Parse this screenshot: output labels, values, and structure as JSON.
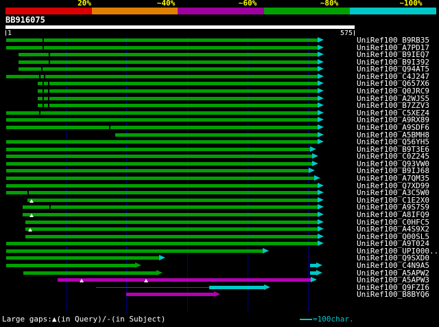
{
  "palette": {
    "background": "#000000",
    "text_white": "#ffffff",
    "label_yellow": "#ffff00",
    "grid_blue": "#000080",
    "green": "#00a000",
    "cyan": "#00c8c8",
    "magenta": "#b400b4",
    "red": "#d80000",
    "orange": "#e08000",
    "purple": "#a000a0",
    "white": "#ffffff",
    "black": "#000000"
  },
  "header": {
    "scale_labels": [
      "20%",
      "~40%",
      "~60%",
      "~80%",
      "~100%"
    ],
    "scale_segment_colors": [
      "red",
      "orange",
      "purple",
      "green",
      "cyan"
    ],
    "query_name": "BB916075",
    "ruler_start": "1",
    "ruler_end": "575"
  },
  "footer": {
    "gaps_legend": "Large gaps:▲(in Query)/-(in Subject)",
    "scale_legend": "=100char."
  },
  "chart_data": {
    "type": "alignment-overview-bar",
    "title": "BLAST hit graphical overview",
    "query_name": "BB916075",
    "query_length": 575,
    "x_range": [
      1,
      575
    ],
    "grid_interval_chars": 100,
    "identity_legend": [
      {
        "label": "20%",
        "color": "red"
      },
      {
        "label": "~40%",
        "color": "orange"
      },
      {
        "label": "~60%",
        "color": "purple"
      },
      {
        "label": "~80%",
        "color": "green"
      },
      {
        "label": "~100%",
        "color": "cyan"
      }
    ],
    "rows": [
      {
        "label": "UniRef100_B9RB35",
        "segments": [
          {
            "color": "green",
            "start": 1,
            "end": 516,
            "arrow": "cyan"
          }
        ],
        "ticks": [
          62
        ],
        "gaps": []
      },
      {
        "label": "UniRef100_A7PD17",
        "segments": [
          {
            "color": "green",
            "start": 1,
            "end": 516,
            "arrow": "cyan"
          }
        ],
        "ticks": [
          62
        ],
        "gaps": []
      },
      {
        "label": "UniRef100_B9IEQ7",
        "segments": [
          {
            "color": "green",
            "start": 22,
            "end": 516,
            "arrow": "cyan"
          }
        ],
        "ticks": [
          73
        ],
        "gaps": []
      },
      {
        "label": "UniRef100_B9I392",
        "segments": [
          {
            "color": "green",
            "start": 22,
            "end": 516,
            "arrow": "cyan"
          }
        ],
        "ticks": [
          73
        ],
        "gaps": []
      },
      {
        "label": "UniRef100_Q94AT5",
        "segments": [
          {
            "color": "green",
            "start": 22,
            "end": 516,
            "arrow": "cyan"
          }
        ],
        "ticks": [
          60
        ],
        "gaps": []
      },
      {
        "label": "UniRef100_C4J247",
        "segments": [
          {
            "color": "green",
            "start": 1,
            "end": 516,
            "arrow": "cyan"
          }
        ],
        "ticks": [
          57,
          65
        ],
        "gaps": []
      },
      {
        "label": "UniRef100_Q657X6",
        "segments": [
          {
            "color": "green",
            "start": 53,
            "end": 516,
            "arrow": "cyan"
          }
        ],
        "ticks": [
          62,
          71
        ],
        "gaps": []
      },
      {
        "label": "UniRef100_Q0JRC9",
        "segments": [
          {
            "color": "green",
            "start": 53,
            "end": 516,
            "arrow": "cyan"
          }
        ],
        "ticks": [
          62,
          71
        ],
        "gaps": []
      },
      {
        "label": "UniRef100_A2WJS5",
        "segments": [
          {
            "color": "green",
            "start": 53,
            "end": 516,
            "arrow": "cyan"
          }
        ],
        "ticks": [
          62,
          71
        ],
        "gaps": []
      },
      {
        "label": "UniRef100_B7ZZV3",
        "segments": [
          {
            "color": "green",
            "start": 53,
            "end": 516,
            "arrow": "cyan"
          }
        ],
        "ticks": [
          62,
          71
        ],
        "gaps": []
      },
      {
        "label": "UniRef100_C5XEZ4",
        "segments": [
          {
            "color": "green",
            "start": 1,
            "end": 516,
            "arrow": "cyan"
          }
        ],
        "ticks": [
          57
        ],
        "gaps": []
      },
      {
        "label": "UniRef100_A9RX89",
        "segments": [
          {
            "color": "green",
            "start": 1,
            "end": 516,
            "arrow": "cyan"
          }
        ],
        "ticks": [],
        "gaps": []
      },
      {
        "label": "UniRef100_A9SDF6",
        "segments": [
          {
            "color": "green",
            "start": 1,
            "end": 516,
            "arrow": "cyan"
          }
        ],
        "ticks": [
          172
        ],
        "gaps": []
      },
      {
        "label": "UniRef100_A5BMH8",
        "segments": [
          {
            "color": "green",
            "start": 181,
            "end": 516,
            "arrow": "cyan"
          }
        ],
        "ticks": [],
        "gaps": []
      },
      {
        "label": "UniRef100_Q56YH5",
        "segments": [
          {
            "color": "green",
            "start": 1,
            "end": 516,
            "arrow": "cyan"
          }
        ],
        "ticks": [],
        "gaps": []
      },
      {
        "label": "UniRef100_B9T3E6",
        "segments": [
          {
            "color": "green",
            "start": 1,
            "end": 503,
            "arrow": "cyan"
          }
        ],
        "ticks": [],
        "gaps": []
      },
      {
        "label": "UniRef100_C0Z245",
        "segments": [
          {
            "color": "green",
            "start": 1,
            "end": 507,
            "arrow": "cyan"
          }
        ],
        "ticks": [],
        "gaps": []
      },
      {
        "label": "UniRef100_Q93VW0",
        "segments": [
          {
            "color": "green",
            "start": 1,
            "end": 507,
            "arrow": "cyan"
          }
        ],
        "ticks": [],
        "gaps": []
      },
      {
        "label": "UniRef100_B9IJ68",
        "segments": [
          {
            "color": "green",
            "start": 1,
            "end": 501,
            "arrow": "cyan"
          }
        ],
        "ticks": [],
        "gaps": []
      },
      {
        "label": "UniRef100_A7QM35",
        "segments": [
          {
            "color": "green",
            "start": 1,
            "end": 510,
            "arrow": "cyan"
          }
        ],
        "ticks": [],
        "gaps": []
      },
      {
        "label": "UniRef100_Q7XD99",
        "segments": [
          {
            "color": "green",
            "start": 1,
            "end": 516,
            "arrow": "cyan"
          }
        ],
        "ticks": [],
        "gaps": []
      },
      {
        "label": "UniRef100_A3C5W0",
        "segments": [
          {
            "color": "green",
            "start": 1,
            "end": 516,
            "arrow": "cyan"
          }
        ],
        "ticks": [
          37
        ],
        "gaps": []
      },
      {
        "label": "UniRef100_C1E2X0",
        "segments": [
          {
            "color": "green",
            "start": 36,
            "end": 516,
            "arrow": "cyan"
          }
        ],
        "ticks": [],
        "gaps": [
          43
        ]
      },
      {
        "label": "UniRef100_A9S7S9",
        "segments": [
          {
            "color": "green",
            "start": 28,
            "end": 516,
            "arrow": "cyan"
          }
        ],
        "ticks": [
          74
        ],
        "gaps": []
      },
      {
        "label": "UniRef100_A8IFQ9",
        "segments": [
          {
            "color": "green",
            "start": 28,
            "end": 516,
            "arrow": "cyan"
          }
        ],
        "ticks": [],
        "gaps": [
          43
        ]
      },
      {
        "label": "UniRef100_C0HFC5",
        "segments": [
          {
            "color": "green",
            "start": 33,
            "end": 516,
            "arrow": "cyan"
          }
        ],
        "ticks": [],
        "gaps": []
      },
      {
        "label": "UniRef100_A4S9X2",
        "segments": [
          {
            "color": "green",
            "start": 33,
            "end": 516,
            "arrow": "cyan"
          }
        ],
        "ticks": [],
        "gaps": [
          41
        ]
      },
      {
        "label": "UniRef100_Q00SL5",
        "segments": [
          {
            "color": "green",
            "start": 33,
            "end": 516,
            "arrow": "cyan"
          }
        ],
        "ticks": [],
        "gaps": []
      },
      {
        "label": "UniRef100_A9T024",
        "segments": [
          {
            "color": "green",
            "start": 1,
            "end": 516,
            "arrow": "cyan"
          }
        ],
        "ticks": [],
        "gaps": []
      },
      {
        "label": "UniRef100_UPI000...",
        "segments": [
          {
            "color": "green",
            "start": 1,
            "end": 425,
            "arrow": "cyan"
          }
        ],
        "ticks": [],
        "gaps": []
      },
      {
        "label": "UniRef100_Q9SXD0",
        "segments": [
          {
            "color": "green",
            "start": 1,
            "end": 254,
            "arrow": "cyan"
          }
        ],
        "ticks": [],
        "gaps": []
      },
      {
        "label": "UniRef100_C4N9A5",
        "segments": [
          {
            "color": "green",
            "start": 1,
            "end": 214,
            "arrow": "green"
          },
          {
            "color": "cyan",
            "start": 504,
            "end": 514,
            "arrow": "cyan"
          }
        ],
        "ticks": [],
        "gaps": []
      },
      {
        "label": "UniRef100_A5APW2",
        "segments": [
          {
            "color": "green",
            "start": 30,
            "end": 249,
            "arrow": "green"
          },
          {
            "color": "cyan",
            "start": 504,
            "end": 514,
            "arrow": "cyan"
          }
        ],
        "ticks": [],
        "gaps": []
      },
      {
        "label": "UniRef100_A5APW3",
        "segments": [
          {
            "color": "magenta",
            "start": 86,
            "end": 505,
            "arrow": "cyan"
          }
        ],
        "ticks": [],
        "gaps": [
          126,
          233
        ]
      },
      {
        "label": "UniRef100_Q9FZI6",
        "segments": [
          {
            "color": "magenta",
            "start": 150,
            "end": 337,
            "thin": true
          },
          {
            "color": "cyan",
            "start": 337,
            "end": 428,
            "arrow": "cyan"
          }
        ],
        "ticks": [],
        "gaps": []
      },
      {
        "label": "UniRef100_B8BYQ6",
        "segments": [
          {
            "color": "magenta",
            "start": 200,
            "end": 345,
            "arrow": "magenta"
          }
        ],
        "ticks": [],
        "gaps": []
      }
    ]
  }
}
